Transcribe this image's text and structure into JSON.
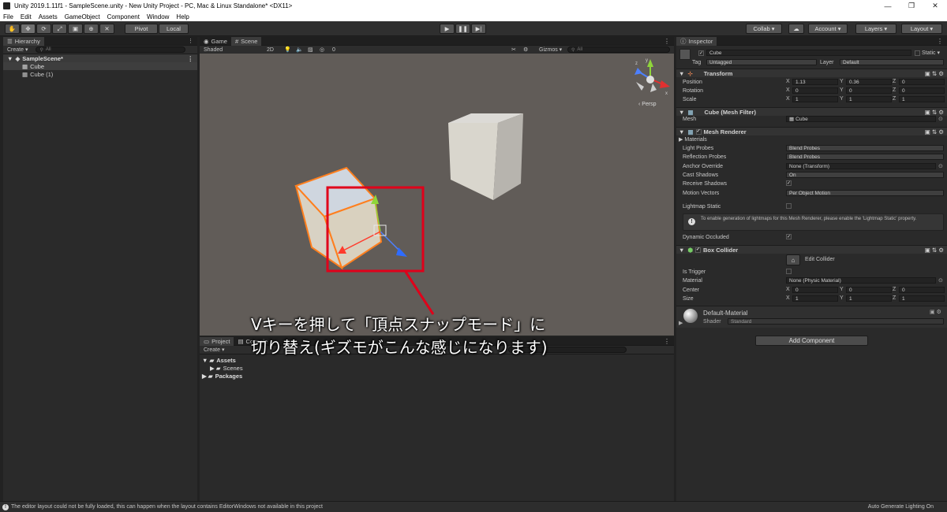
{
  "window": {
    "title": "Unity 2019.1.11f1 - SampleScene.unity - New Unity Project - PC, Mac & Linux Standalone* <DX11>",
    "min": "—",
    "max": "❐",
    "close": "✕"
  },
  "menu": [
    "File",
    "Edit",
    "Assets",
    "GameObject",
    "Component",
    "Window",
    "Help"
  ],
  "toolbar": {
    "pivot": "Pivot",
    "local": "Local",
    "collab": "Collab ▾",
    "account": "Account ▾",
    "layers": "Layers ▾",
    "layout": "Layout ▾"
  },
  "hierarchy": {
    "tab": "Hierarchy",
    "create": "Create ▾",
    "search": "All",
    "scene": "SampleScene*",
    "items": [
      "Cube",
      "Cube (1)"
    ]
  },
  "scene": {
    "tabs": [
      "Game",
      "Scene"
    ],
    "shaded": "Shaded",
    "mode2d": "2D",
    "fxcount": "0",
    "gizmos": "Gizmos ▾",
    "search": "All",
    "persp": "Persp",
    "axes": {
      "x": "x",
      "y": "y",
      "z": "z"
    }
  },
  "project": {
    "tabs": [
      "Project",
      "Console"
    ],
    "create": "Create ▾",
    "tree": [
      "Assets",
      "Scenes",
      "Packages"
    ]
  },
  "inspector": {
    "tab": "Inspector",
    "name": "Cube",
    "static": "Static ▾",
    "tag_label": "Tag",
    "tag": "Untagged",
    "layer_label": "Layer",
    "layer": "Default",
    "transform": {
      "title": "Transform",
      "rows": [
        {
          "label": "Position",
          "x": "1.13",
          "y": "0.36",
          "z": "0"
        },
        {
          "label": "Rotation",
          "x": "0",
          "y": "0",
          "z": "0"
        },
        {
          "label": "Scale",
          "x": "1",
          "y": "1",
          "z": "1"
        }
      ]
    },
    "meshfilter": {
      "title": "Cube (Mesh Filter)",
      "mesh_label": "Mesh",
      "mesh": "Cube"
    },
    "renderer": {
      "title": "Mesh Renderer",
      "materials": "Materials",
      "light_probes": "Light Probes",
      "light_probes_val": "Blend Probes",
      "reflection_probes": "Reflection Probes",
      "reflection_probes_val": "Blend Probes",
      "anchor": "Anchor Override",
      "anchor_val": "None (Transform)",
      "cast": "Cast Shadows",
      "cast_val": "On",
      "receive": "Receive Shadows",
      "motion": "Motion Vectors",
      "motion_val": "Per Object Motion",
      "lightmap": "Lightmap Static",
      "info": "To enable generation of lightmaps for this Mesh Renderer, please enable the 'Lightmap Static' property.",
      "occluded": "Dynamic Occluded"
    },
    "boxcollider": {
      "title": "Box Collider",
      "edit": "Edit Collider",
      "trigger": "Is Trigger",
      "material": "Material",
      "material_val": "None (Physic Material)",
      "center": {
        "label": "Center",
        "x": "0",
        "y": "0",
        "z": "0"
      },
      "size": {
        "label": "Size",
        "x": "1",
        "y": "1",
        "z": "1"
      }
    },
    "material": {
      "name": "Default-Material",
      "shader_label": "Shader",
      "shader": "Standard"
    },
    "add_component": "Add Component"
  },
  "status": {
    "message": "The editor layout could not be fully loaded, this can happen when the layout contains EditorWindows not available in this project",
    "right": "Auto Generate Lighting On"
  },
  "annotation": {
    "line1": "Vキーを押して「頂点スナップモード」に",
    "line2": "切り替え(ギズモがこんな感じになります)"
  },
  "colors": {
    "annotation_red": "#e0001a",
    "selection_orange": "#ff7f1e",
    "scene_bg": "#615c58"
  }
}
